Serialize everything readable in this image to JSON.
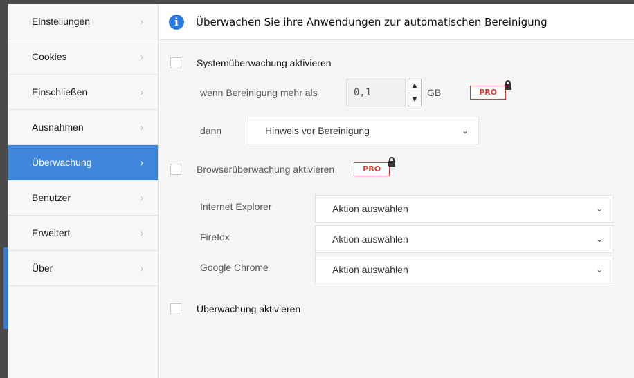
{
  "sidebar": {
    "items": [
      {
        "label": "Einstellungen",
        "active": false
      },
      {
        "label": "Cookies",
        "active": false
      },
      {
        "label": "Einschließen",
        "active": false
      },
      {
        "label": "Ausnahmen",
        "active": false
      },
      {
        "label": "Überwachung",
        "active": true
      },
      {
        "label": "Benutzer",
        "active": false
      },
      {
        "label": "Erweitert",
        "active": false
      },
      {
        "label": "Über",
        "active": false
      }
    ]
  },
  "header": {
    "icon": "info-icon",
    "title": "Überwachen Sie ihre Anwendungen zur automatischen Bereinigung"
  },
  "system_monitoring": {
    "checkbox_label": "Systemüberwachung aktivieren",
    "checked": false,
    "threshold_label": "wenn Bereinigung mehr als",
    "threshold_value": "0,1",
    "threshold_unit": "GB",
    "pro_badge": "PRO",
    "then_label": "dann",
    "then_select": "Hinweis vor Bereinigung"
  },
  "browser_monitoring": {
    "checkbox_label": "Browserüberwachung aktivieren",
    "checked": false,
    "pro_badge": "PRO",
    "browsers": [
      {
        "name": "Internet Explorer",
        "action": "Aktion auswählen"
      },
      {
        "name": "Firefox",
        "action": "Aktion auswählen"
      },
      {
        "name": "Google Chrome",
        "action": "Aktion auswählen"
      }
    ]
  },
  "monitoring": {
    "checkbox_label": "Überwachung aktivieren",
    "checked": false
  },
  "colors": {
    "accent": "#3d86dc",
    "pro_red": "#d93a34",
    "info_blue": "#2a7be0"
  }
}
